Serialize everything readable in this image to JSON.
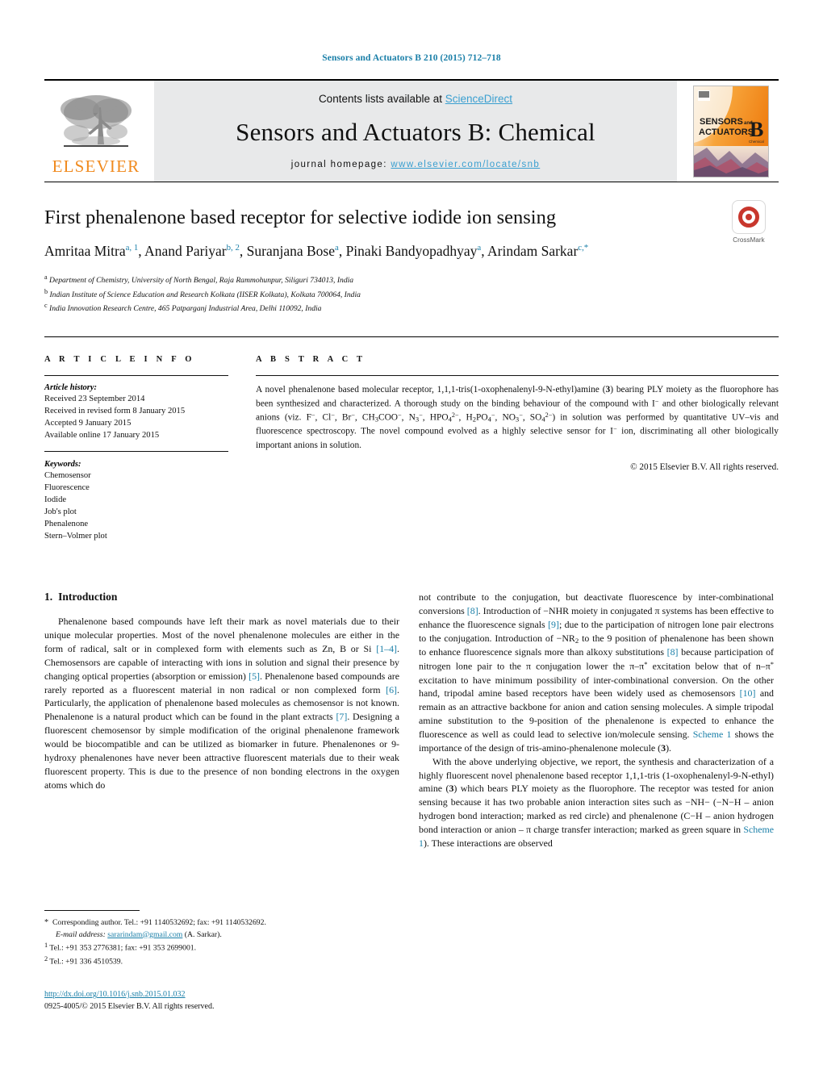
{
  "running_head": "Sensors and Actuators B 210 (2015) 712–718",
  "masthead": {
    "publisher_logo_text": "ELSEVIER",
    "contents_prefix": "Contents lists available at ",
    "contents_link": "ScienceDirect",
    "journal_title": "Sensors and Actuators B: Chemical",
    "homepage_label": "journal homepage:",
    "homepage_url": "www.elsevier.com/locate/snb",
    "cover_line1": "SENSORS",
    "cover_and": "and",
    "cover_line2": "ACTUATORS",
    "cover_b": "B",
    "cover_sub": "Chemical",
    "accent_orange": "#f08a1e",
    "link_blue": "#3a9fd0"
  },
  "article": {
    "title": "First phenalenone based receptor for selective iodide ion sensing",
    "authors_html": "Amritaa Mitra<sup>a, 1</sup>, Anand Pariyar<sup>b, 2</sup>, Suranjana Bose<sup>a</sup>, Pinaki Bandyopadhyay<sup>a</sup>, Arindam Sarkar<sup>c,*</sup>",
    "affiliations": [
      {
        "mark": "a",
        "text": "Department of Chemistry, University of North Bengal, Raja Rammohunpur, Siliguri 734013, India"
      },
      {
        "mark": "b",
        "text": "Indian Institute of Science Education and Research Kolkata (IISER Kolkata), Kolkata 700064, India"
      },
      {
        "mark": "c",
        "text": "India Innovation Research Centre, 465 Patparganj Industrial Area, Delhi 110092, India"
      }
    ],
    "crossmark_label": "CrossMark"
  },
  "article_info": {
    "heading": "A R T I C L E   I N F O",
    "history_label": "Article history:",
    "history": [
      "Received 23 September 2014",
      "Received in revised form 8 January 2015",
      "Accepted 9 January 2015",
      "Available online 17 January 2015"
    ],
    "keywords_label": "Keywords:",
    "keywords": [
      "Chemosensor",
      "Fluorescence",
      "Iodide",
      "Job's plot",
      "Phenalenone",
      "Stern–Volmer plot"
    ]
  },
  "abstract": {
    "heading": "A B S T R A C T",
    "text_html": "A novel phenalenone based molecular receptor, 1,1,1-tris(1-oxophenalenyl-9-N-ethyl)amine (<b>3</b>) bearing PLY moiety as the fluorophore has been synthesized and characterized. A thorough study on the binding behaviour of the compound with I<sup>−</sup> and other biologically relevant anions (viz. F<sup>−</sup>, Cl<sup>−</sup>, Br<sup>−</sup>, CH<sub>3</sub>COO<sup>−</sup>, N<sub>3</sub><sup>−</sup>, HPO<sub>4</sub><sup>2−</sup>, H<sub>2</sub>PO<sub>4</sub><sup>−</sup>, NO<sub>3</sub><sup>−</sup>, SO<sub>4</sub><sup>2−</sup>) in solution was performed by quantitative UV–vis and fluorescence spectroscopy. The novel compound evolved as a highly selective sensor for I<sup>−</sup> ion, discriminating all other biologically important anions in solution.",
    "copyright": "© 2015 Elsevier B.V. All rights reserved."
  },
  "body": {
    "section_number": "1.",
    "section_title": "Introduction",
    "left_paragraphs_html": [
      "Phenalenone based compounds have left their mark as novel materials due to their unique molecular properties. Most of the novel phenalenone molecules are either in the form of radical, salt or in complexed form with elements such as Zn, B or Si <span class=\"ref\">[1–4]</span>. Chemosensors are capable of interacting with ions in solution and signal their presence by changing optical properties (absorption or emission) <span class=\"ref\">[5]</span>. Phenalenone based compounds are rarely reported as a fluorescent material in non radical or non complexed form <span class=\"ref\">[6]</span>. Particularly, the application of phenalenone based molecules as chemosensor is not known. Phenalenone is a natural product which can be found in the plant extracts <span class=\"ref\">[7]</span>. Designing a fluorescent chemosensor by simple modification of the original phenalenone framework would be biocompatible and can be utilized as biomarker in future. Phenalenones or 9-hydroxy phenalenones have never been attractive fluorescent materials due to their weak fluorescent property. This is due to the presence of non bonding electrons in the oxygen atoms which do"
    ],
    "right_paragraphs_html": [
      "not contribute to the conjugation, but deactivate fluorescence by inter-combinational conversions <span class=\"ref\">[8]</span>. Introduction of −NHR moiety in conjugated π systems has been effective to enhance the fluorescence signals <span class=\"ref\">[9]</span>; due to the participation of nitrogen lone pair electrons to the conjugation. Introduction of −NR<sub>2</sub> to the 9 position of phenalenone has been shown to enhance fluorescence signals more than alkoxy substitutions <span class=\"ref\">[8]</span> because participation of nitrogen lone pair to the π conjugation lower the π–π<sup>*</sup> excitation below that of n–π<sup>*</sup> excitation to have minimum possibility of inter-combinational conversion. On the other hand, tripodal amine based receptors have been widely used as chemosensors <span class=\"ref\">[10]</span> and remain as an attractive backbone for anion and cation sensing molecules. A simple tripodal amine substitution to the 9-position of the phenalenone is expected to enhance the fluorescence as well as could lead to selective ion/molecule sensing. <span class=\"xref\">Scheme 1</span> shows the importance of the design of tris-amino-phenalenone molecule (<b>3</b>).",
      "With the above underlying objective, we report, the synthesis and characterization of a highly fluorescent novel phenalenone based receptor 1,1,1-tris (1-oxophenalenyl-9-N-ethyl) amine (<b>3</b>) which bears PLY moiety as the fluorophore. The receptor was tested for anion sensing because it has two probable anion interaction sites such as −NH− (−N−H – anion hydrogen bond interaction; marked as red circle) and phenalenone (C−H – anion hydrogen bond interaction or anion – π charge transfer interaction; marked as green square in <span class=\"xref\">Scheme 1</span>). These interactions are observed"
    ]
  },
  "footnotes": {
    "corresponding_html": "<span class=\"star\">*</span>&nbsp; Corresponding author. Tel.: +91 1140532692; fax: +91 1140532692.",
    "email_label": "E-mail address:",
    "email": "sararindam@gmail.com",
    "email_suffix": "(A. Sarkar).",
    "note1_html": "<sup>1</sup> Tel.: +91 353 2776381; fax: +91 353 2699001.",
    "note2_html": "<sup>2</sup> Tel.: +91 336 4510539."
  },
  "footer": {
    "doi": "http://dx.doi.org/10.1016/j.snb.2015.01.032",
    "issn_line": "0925-4005/© 2015 Elsevier B.V. All rights reserved."
  }
}
